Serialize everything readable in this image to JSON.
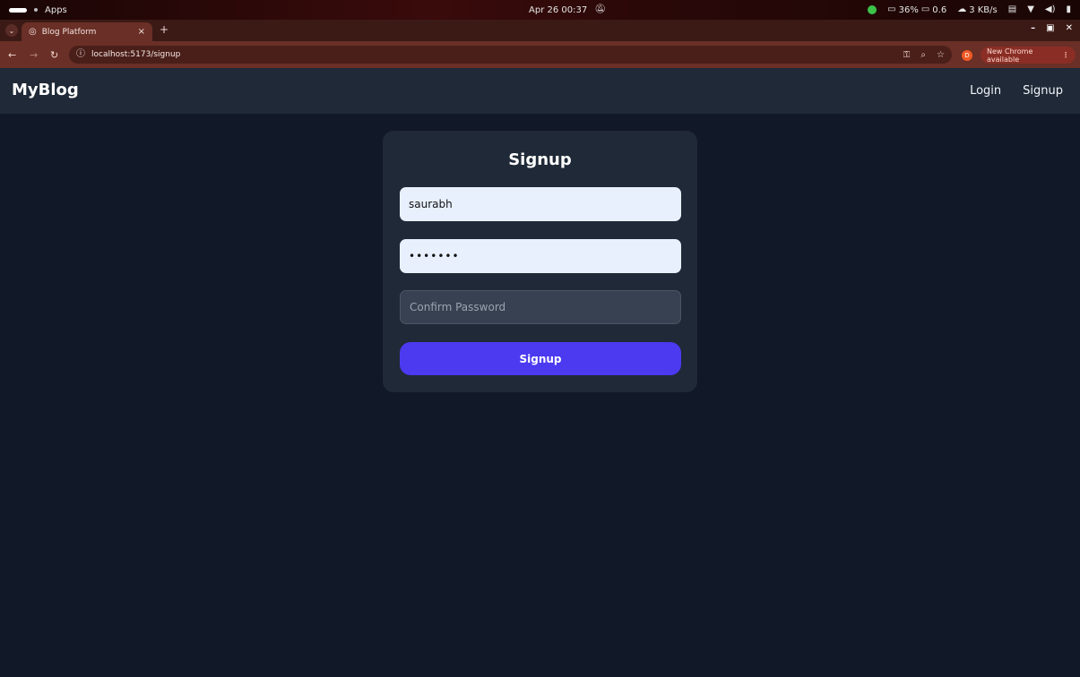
{
  "os": {
    "apps_label": "Apps",
    "datetime": "Apr 26  00:37",
    "battery": "36%",
    "load": "0.6",
    "network": "3 KB/s"
  },
  "browser": {
    "tab_title": "Blog Platform",
    "url": "localhost:5173/signup",
    "profile_initial": "D",
    "update_label": "New Chrome available"
  },
  "app": {
    "brand": "MyBlog",
    "nav": {
      "login": "Login",
      "signup": "Signup"
    }
  },
  "form": {
    "title": "Signup",
    "username_value": "saurabh",
    "password_value": "•••••••",
    "confirm_placeholder": "Confirm Password",
    "confirm_value": "",
    "submit_label": "Signup"
  },
  "colors": {
    "page_bg": "#111827",
    "card_bg": "#1f2937",
    "accent": "#4b3af0"
  }
}
